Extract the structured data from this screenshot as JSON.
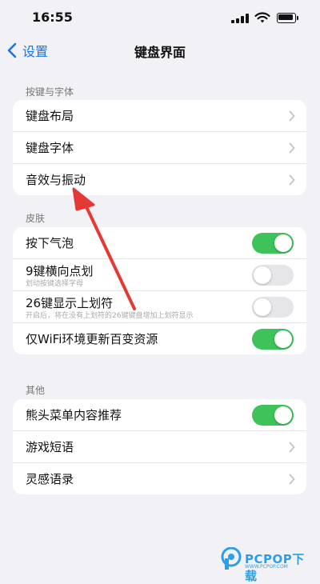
{
  "status_bar": {
    "time": "16:55"
  },
  "nav": {
    "back_label": "设置",
    "title": "键盘界面"
  },
  "sections": {
    "keys_fonts": {
      "header": "按键与字体",
      "rows": [
        "键盘布局",
        "键盘字体",
        "音效与振动"
      ]
    },
    "skin": {
      "header": "皮肤",
      "rows": [
        {
          "label": "按下气泡",
          "toggle": true
        },
        {
          "label": "9键横向点划",
          "sub": "划动按键选择字母",
          "toggle": false
        },
        {
          "label": "26键显示上划符",
          "sub": "开启后，将在没有上划符的26键键盘增加上划符显示",
          "toggle": false
        },
        {
          "label": "仅WiFi环境更新百变资源",
          "toggle": true
        }
      ]
    },
    "other": {
      "header": "其他",
      "rows": [
        {
          "label": "熊头菜单内容推荐",
          "toggle": true
        },
        {
          "label": "游戏短语"
        },
        {
          "label": "灵感语录"
        }
      ]
    }
  },
  "colors": {
    "accent": "#1a73e8",
    "toggle_on": "#3dc35a",
    "annotation_arrow": "#e53935"
  },
  "watermark": {
    "brand": "PCPOP下载",
    "sub": "WWW.PCPOP.COM"
  }
}
